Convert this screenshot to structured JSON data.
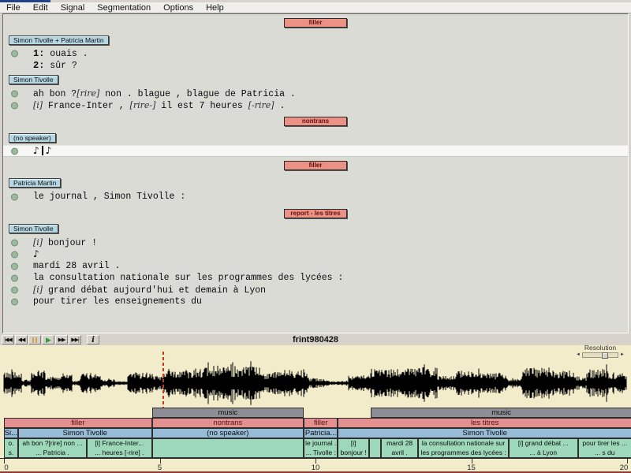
{
  "menu": {
    "items": [
      "File",
      "Edit",
      "Signal",
      "Segmentation",
      "Options",
      "Help"
    ]
  },
  "editor": {
    "blocks": [
      {
        "type": "section",
        "label": "filler"
      },
      {
        "type": "speaker",
        "label": "Simon Tivolle + Patricia Martin",
        "mt": 5
      },
      {
        "type": "line",
        "bullet": true,
        "mt": 1,
        "parts": [
          {
            "t": "num",
            "v": "1:"
          },
          {
            "t": "text",
            "v": " ouais ."
          }
        ]
      },
      {
        "type": "line",
        "bullet": false,
        "mt": 0,
        "parts": [
          {
            "t": "num",
            "v": "2:"
          },
          {
            "t": "text",
            "v": " sûr ?"
          }
        ]
      },
      {
        "type": "speaker",
        "label": "Simon Tivolle",
        "mt": 1
      },
      {
        "type": "line",
        "bullet": true,
        "mt": 2,
        "parts": [
          {
            "t": "text",
            "v": "ah bon ?"
          },
          {
            "t": "event",
            "v": "[rire]"
          },
          {
            "t": "text",
            "v": " non . blague , blague de Patricia ."
          }
        ]
      },
      {
        "type": "line",
        "bullet": true,
        "mt": 0,
        "parts": [
          {
            "t": "event",
            "v": "[i]"
          },
          {
            "t": "text",
            "v": " France-Inter , "
          },
          {
            "t": "event",
            "v": "[rire-]"
          },
          {
            "t": "text",
            "v": " il est 7 heures "
          },
          {
            "t": "event",
            "v": "[-rire]"
          },
          {
            "t": "text",
            "v": " ."
          }
        ]
      },
      {
        "type": "section",
        "label": "nontrans",
        "mt": 2
      },
      {
        "type": "speaker",
        "label": "(no speaker)",
        "mt": 4
      },
      {
        "type": "line",
        "bullet": true,
        "selected": true,
        "mt": 1,
        "parts": [
          {
            "t": "music",
            "v": "♪"
          },
          {
            "t": "cursor",
            "v": "|"
          },
          {
            "t": "music",
            "v": "♪"
          }
        ]
      },
      {
        "type": "section",
        "label": "filler",
        "mt": 0
      },
      {
        "type": "speaker",
        "label": "Patricia Martin",
        "mt": 5
      },
      {
        "type": "line",
        "bullet": true,
        "mt": 2,
        "parts": [
          {
            "t": "text",
            "v": "le journal , Simon Tivolle :"
          }
        ]
      },
      {
        "type": "section",
        "label": "report - les titres",
        "mt": 3
      },
      {
        "type": "speaker",
        "label": "Simon Tivolle",
        "mt": 2
      },
      {
        "type": "line",
        "bullet": true,
        "mt": 2,
        "parts": [
          {
            "t": "event",
            "v": "[i]"
          },
          {
            "t": "text",
            "v": " bonjour !"
          }
        ]
      },
      {
        "type": "line",
        "bullet": true,
        "mt": 0,
        "parts": [
          {
            "t": "music",
            "v": "♪"
          }
        ]
      },
      {
        "type": "line",
        "bullet": true,
        "mt": 0,
        "parts": [
          {
            "t": "text",
            "v": "mardi 28 avril ."
          }
        ]
      },
      {
        "type": "line",
        "bullet": true,
        "mt": 0,
        "parts": [
          {
            "t": "text",
            "v": "la consultation nationale sur les programmes des lycées :"
          }
        ]
      },
      {
        "type": "line",
        "bullet": true,
        "mt": 0,
        "parts": [
          {
            "t": "event",
            "v": "[i]"
          },
          {
            "t": "text",
            "v": " grand débat aujourd'hui et demain à Lyon"
          }
        ]
      },
      {
        "type": "line",
        "bullet": true,
        "mt": 0,
        "parts": [
          {
            "t": "text",
            "v": "pour tirer les enseignements du"
          }
        ]
      }
    ]
  },
  "toolbar": {
    "title": "frint980428",
    "buttons": [
      {
        "name": "skip-to-start-button",
        "kind": "glyph",
        "glyph": "|◀◀"
      },
      {
        "name": "rewind-button",
        "kind": "glyph",
        "glyph": "◀◀"
      },
      {
        "name": "pause-button",
        "kind": "pause"
      },
      {
        "name": "play-button",
        "kind": "play",
        "glyph": "▶"
      },
      {
        "name": "fast-forward-button",
        "kind": "glyph",
        "glyph": "▶▶"
      },
      {
        "name": "skip-to-end-button",
        "kind": "glyph",
        "glyph": "▶▶|"
      },
      {
        "name": "info-button",
        "kind": "info",
        "glyph": "i"
      }
    ]
  },
  "signal": {
    "resolution_label": "Resolution",
    "cursor_time": 5.12,
    "axis": {
      "start": 0,
      "end": 20,
      "label_step": 5,
      "labels": [
        "0",
        "5",
        "10",
        "15",
        "20"
      ]
    },
    "tracks": {
      "music": {
        "segments": [
          {
            "start": 4.75,
            "end": 9.62,
            "label": "music"
          },
          {
            "start": 11.78,
            "end": 20.15,
            "label": "music"
          }
        ]
      },
      "sections": {
        "segments": [
          {
            "start": 0,
            "end": 4.75,
            "label": "filler"
          },
          {
            "start": 4.75,
            "end": 9.62,
            "label": "nontrans"
          },
          {
            "start": 9.62,
            "end": 10.72,
            "label": "filler"
          },
          {
            "start": 10.72,
            "end": 20.15,
            "label": "les titres"
          }
        ]
      },
      "speakers": {
        "segments": [
          {
            "start": 0,
            "end": 0.45,
            "label": "Si..."
          },
          {
            "start": 0.45,
            "end": 4.75,
            "label": "Simon Tivolle"
          },
          {
            "start": 4.75,
            "end": 9.62,
            "label": "(no speaker)"
          },
          {
            "start": 9.62,
            "end": 10.72,
            "label": "Patricia..."
          },
          {
            "start": 10.72,
            "end": 20.15,
            "label": "Simon Tivolle"
          }
        ]
      },
      "transcript": {
        "segments": [
          {
            "start": 0,
            "end": 0.45,
            "lines": [
              "o.",
              "s."
            ]
          },
          {
            "start": 0.45,
            "end": 2.66,
            "lines": [
              "ah bon ?[rire] non ...",
              "... Patricia ."
            ]
          },
          {
            "start": 2.66,
            "end": 4.75,
            "lines": [
              "[i] France-Inter...",
              "... heures [-rire] ."
            ]
          },
          {
            "start": 4.75,
            "end": 9.62,
            "lines": [
              "",
              ""
            ]
          },
          {
            "start": 9.62,
            "end": 10.72,
            "lines": [
              "le journal .",
              "... Tivolle :"
            ]
          },
          {
            "start": 10.72,
            "end": 11.72,
            "lines": [
              "[i]",
              "bonjour !"
            ]
          },
          {
            "start": 11.72,
            "end": 12.1,
            "lines": [
              "",
              ""
            ]
          },
          {
            "start": 12.1,
            "end": 13.3,
            "lines": [
              "mardi 28",
              "avril ."
            ]
          },
          {
            "start": 13.3,
            "end": 16.2,
            "lines": [
              "la consultation nationale sur",
              "les programmes des lycées :"
            ]
          },
          {
            "start": 16.2,
            "end": 18.42,
            "lines": [
              "[i] grand débat ...",
              "... à Lyon"
            ]
          },
          {
            "start": 18.42,
            "end": 20.15,
            "lines": [
              "pour tirer les ...",
              "... s du"
            ]
          }
        ]
      }
    }
  }
}
